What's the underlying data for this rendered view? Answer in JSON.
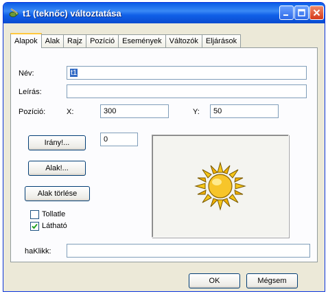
{
  "window": {
    "title": "t1 (teknőc) változtatása",
    "title_icon": "turtle-pen-icon",
    "buttons": [
      "minimize-icon",
      "maximize-icon",
      "close-icon"
    ]
  },
  "tabs": [
    {
      "label": "Alapok",
      "active": true
    },
    {
      "label": "Alak"
    },
    {
      "label": "Rajz"
    },
    {
      "label": "Pozíció"
    },
    {
      "label": "Események"
    },
    {
      "label": "Változók"
    },
    {
      "label": "Eljárások"
    }
  ],
  "form": {
    "name_label": "Név:",
    "name_value": "t1",
    "description_label": "Leírás:",
    "description_value": "",
    "position_label": "Pozíció:",
    "x_label": "X:",
    "x_value": "300",
    "y_label": "Y:",
    "y_value": "50",
    "direction_button": "Irány!...",
    "direction_value": "0",
    "shape_button": "Alak!...",
    "delete_shape_button": "Alak törlése",
    "pen_up_label": "Tollatle",
    "pen_up_checked": false,
    "visible_label": "Látható",
    "visible_checked": true,
    "on_click_label": "haKlikk:",
    "on_click_value": "",
    "preview_icon": "sun-icon"
  },
  "footer": {
    "ok_label": "OK",
    "cancel_label": "Mégsem"
  },
  "colors": {
    "titlebar": "#0a5ce6",
    "selection": "#316ac5",
    "active_tab_accent": "#ffc83c",
    "sun": "#f5c518"
  }
}
